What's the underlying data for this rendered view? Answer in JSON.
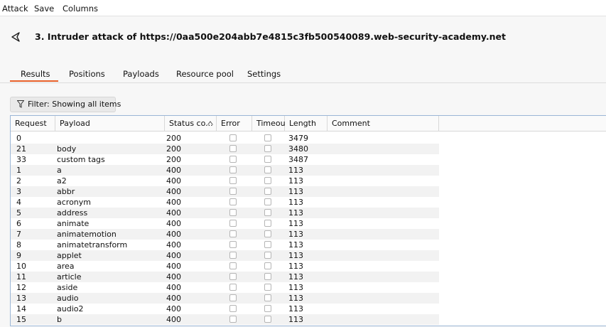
{
  "menu": [
    "Attack",
    "Save",
    "Columns"
  ],
  "title": "3. Intruder attack of https://0aa500e204abb7e4815c3fb500540089.web-security-academy.net",
  "tabs": [
    "Results",
    "Positions",
    "Payloads",
    "Resource pool",
    "Settings"
  ],
  "active_tab": "Results",
  "filter_label": "Filter: Showing all items",
  "columns": [
    "Request",
    "Payload",
    "Status co...",
    "Error",
    "Timeout",
    "Length",
    "Comment"
  ],
  "rows": [
    {
      "request": "0",
      "payload": "",
      "status": "200",
      "length": "3479"
    },
    {
      "request": "21",
      "payload": "body",
      "status": "200",
      "length": "3480"
    },
    {
      "request": "33",
      "payload": "custom tags",
      "status": "200",
      "length": "3487"
    },
    {
      "request": "1",
      "payload": "a",
      "status": "400",
      "length": "113"
    },
    {
      "request": "2",
      "payload": "a2",
      "status": "400",
      "length": "113"
    },
    {
      "request": "3",
      "payload": "abbr",
      "status": "400",
      "length": "113"
    },
    {
      "request": "4",
      "payload": "acronym",
      "status": "400",
      "length": "113"
    },
    {
      "request": "5",
      "payload": "address",
      "status": "400",
      "length": "113"
    },
    {
      "request": "6",
      "payload": "animate",
      "status": "400",
      "length": "113"
    },
    {
      "request": "7",
      "payload": "animatemotion",
      "status": "400",
      "length": "113"
    },
    {
      "request": "8",
      "payload": "animatetransform",
      "status": "400",
      "length": "113"
    },
    {
      "request": "9",
      "payload": "applet",
      "status": "400",
      "length": "113"
    },
    {
      "request": "10",
      "payload": "area",
      "status": "400",
      "length": "113"
    },
    {
      "request": "11",
      "payload": "article",
      "status": "400",
      "length": "113"
    },
    {
      "request": "12",
      "payload": "aside",
      "status": "400",
      "length": "113"
    },
    {
      "request": "13",
      "payload": "audio",
      "status": "400",
      "length": "113"
    },
    {
      "request": "14",
      "payload": "audio2",
      "status": "400",
      "length": "113"
    },
    {
      "request": "15",
      "payload": "b",
      "status": "400",
      "length": "113"
    }
  ],
  "colors": {
    "accent": "#e8602a",
    "table_border": "#9bb6d6"
  },
  "icons": {
    "title": "send-arrow-icon",
    "filter": "funnel-icon",
    "sort": "chevron-up-icon"
  }
}
